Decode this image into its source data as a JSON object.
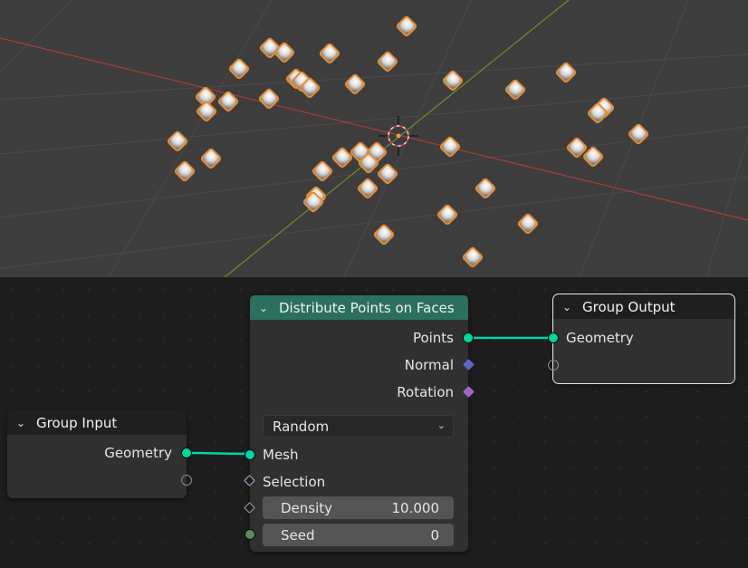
{
  "nodes": {
    "group_input": {
      "title": "Group Input",
      "outputs": [
        "Geometry"
      ]
    },
    "distribute": {
      "title": "Distribute Points on Faces",
      "outputs": [
        "Points",
        "Normal",
        "Rotation"
      ],
      "mode": "Random",
      "inputs": {
        "mesh": "Mesh",
        "selection": "Selection",
        "density_label": "Density",
        "density_value": "10.000",
        "seed_label": "Seed",
        "seed_value": "0"
      }
    },
    "group_output": {
      "title": "Group Output",
      "inputs": [
        "Geometry"
      ]
    }
  },
  "colors": {
    "viewport_bg": "#3d3d3d",
    "node_editor_bg": "#1d1d1d",
    "geometry_socket": "#00d6a3",
    "distribute_header": "#2b6f5f",
    "x_axis": "#a83d3d",
    "y_axis": "#6a8f2e",
    "selection_outline": "#e88c30"
  },
  "icons": {
    "collapse": "chevron-down-icon",
    "dropdown": "chevron-down-icon",
    "origin": "3d-cursor-icon",
    "point": "selected-point-icon"
  }
}
